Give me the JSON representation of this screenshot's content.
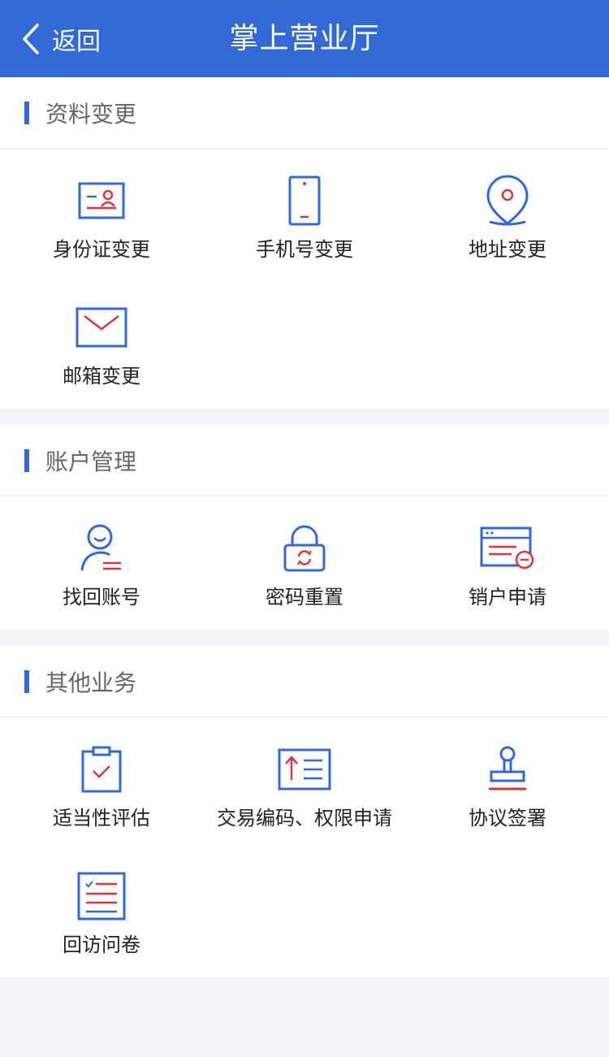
{
  "header": {
    "back_label": "返回",
    "title": "掌上营业厅"
  },
  "colors": {
    "brand_blue": "#3369d6",
    "accent_red": "#d9363e"
  },
  "sections": [
    {
      "title": "资料变更",
      "items": [
        {
          "label": "身份证变更",
          "icon": "id-card-icon"
        },
        {
          "label": "手机号变更",
          "icon": "mobile-phone-icon"
        },
        {
          "label": "地址变更",
          "icon": "location-pin-icon"
        },
        {
          "label": "邮箱变更",
          "icon": "envelope-icon"
        }
      ]
    },
    {
      "title": "账户管理",
      "items": [
        {
          "label": "找回账号",
          "icon": "user-icon"
        },
        {
          "label": "密码重置",
          "icon": "padlock-refresh-icon"
        },
        {
          "label": "销户申请",
          "icon": "browser-minus-icon"
        }
      ]
    },
    {
      "title": "其他业务",
      "items": [
        {
          "label": "适当性评估",
          "icon": "clipboard-check-icon"
        },
        {
          "label": "交易编码、权限申请",
          "icon": "upload-list-icon"
        },
        {
          "label": "协议签署",
          "icon": "stamp-icon"
        },
        {
          "label": "回访问卷",
          "icon": "questionnaire-icon"
        }
      ]
    }
  ]
}
